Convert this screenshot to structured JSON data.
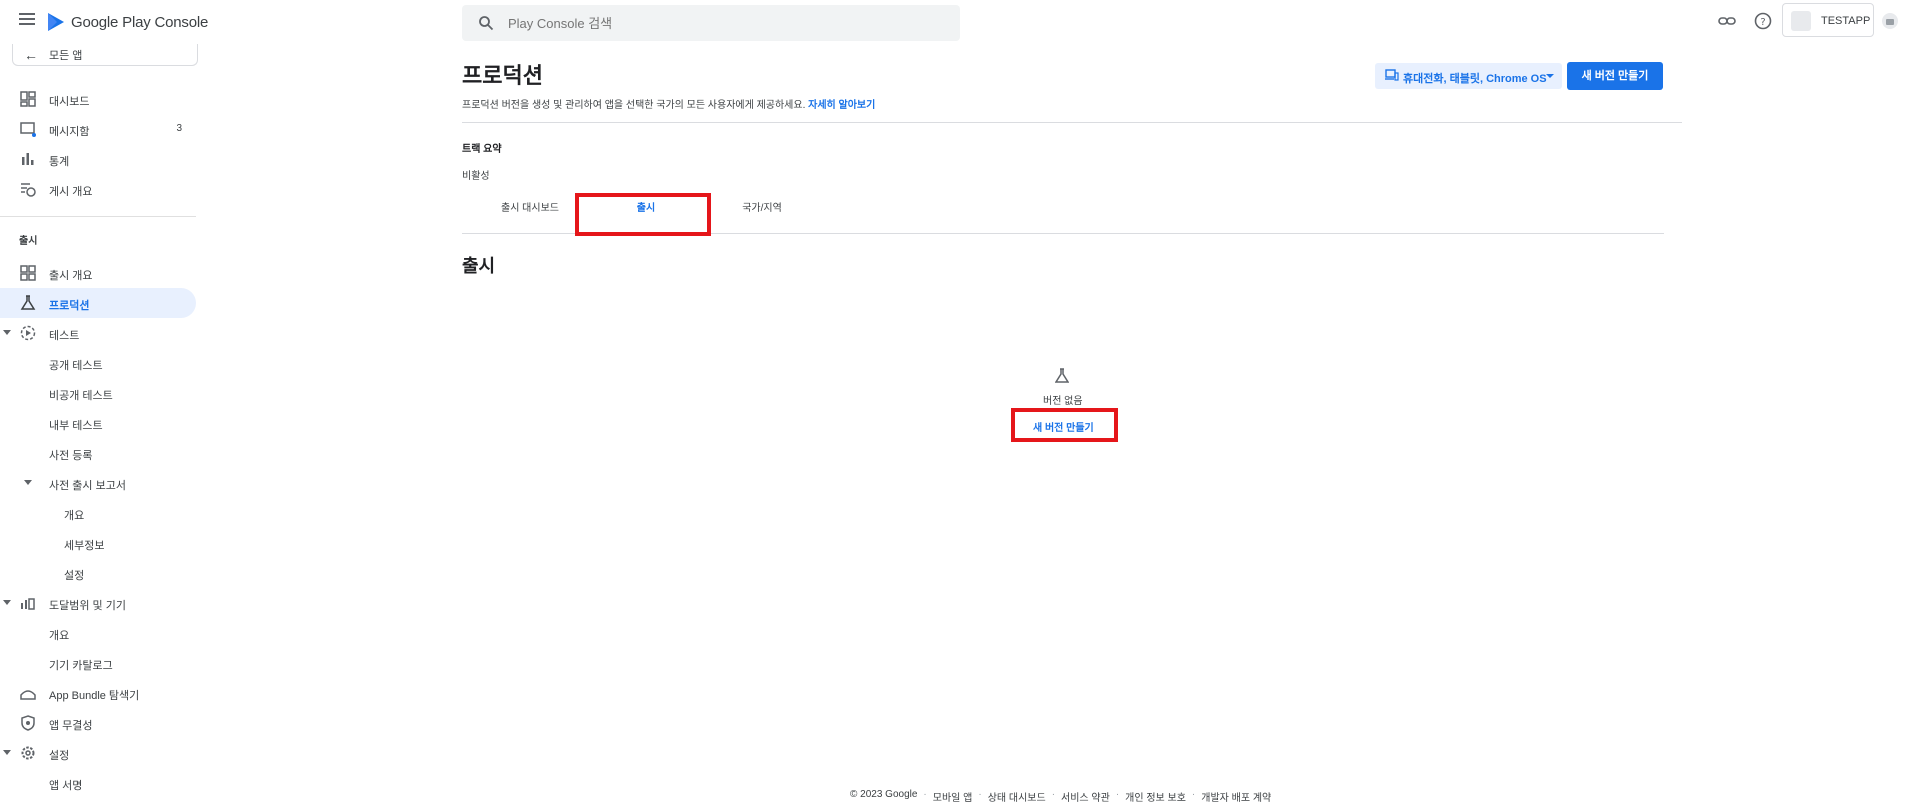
{
  "app": {
    "logo_text": "Google Play Console"
  },
  "search": {
    "placeholder": "Play Console 검색"
  },
  "account": {
    "name": "TESTAPP"
  },
  "sidebar": {
    "back_label": "모든 앱",
    "items": [
      {
        "label": "대시보드"
      },
      {
        "label": "메시지함",
        "count": "3"
      },
      {
        "label": "통계"
      },
      {
        "label": "게시 개요"
      }
    ],
    "section_release": "출시",
    "release_items": [
      {
        "label": "출시 개요"
      },
      {
        "label": "프로덕션"
      },
      {
        "label": "테스트"
      },
      {
        "label": "공개 테스트"
      },
      {
        "label": "비공개 테스트"
      },
      {
        "label": "내부 테스트"
      },
      {
        "label": "사전 등록"
      },
      {
        "label": "사전 출시 보고서"
      },
      {
        "label": "개요"
      },
      {
        "label": "세부정보"
      },
      {
        "label": "설정"
      },
      {
        "label": "도달범위 및 기기"
      },
      {
        "label": "개요"
      },
      {
        "label": "기기 카탈로그"
      },
      {
        "label": "App Bundle 탐색기"
      },
      {
        "label": "앱 무결성"
      },
      {
        "label": "설정"
      },
      {
        "label": "앱 서명"
      }
    ]
  },
  "main": {
    "title": "프로덕션",
    "description": "프로덕션 버전을 생성 및 관리하여 앱을 선택한 국가의 모든 사용자에게 제공하세요.",
    "learn_more": "자세히 알아보기",
    "device_filter": "휴대전화, 태블릿, Chrome OS",
    "create_release": "새 버전 만들기",
    "track_summary_label": "트랙 요약",
    "track_status": "비활성",
    "tabs": [
      {
        "label": "출시 대시보드"
      },
      {
        "label": "출시"
      },
      {
        "label": "국가/지역"
      }
    ],
    "section_title": "출시",
    "empty_text": "버전 없음",
    "empty_link": "새 버전 만들기"
  },
  "footer": {
    "copyright": "© 2023 Google",
    "links": [
      "모바일 앱",
      "상태 대시보드",
      "서비스 약관",
      "개인 정보 보호",
      "개발자 배포 계약"
    ]
  },
  "colors": {
    "accent": "#1a73e8",
    "highlight_box": "#e5161a",
    "active_bg": "#e8f0fe"
  }
}
